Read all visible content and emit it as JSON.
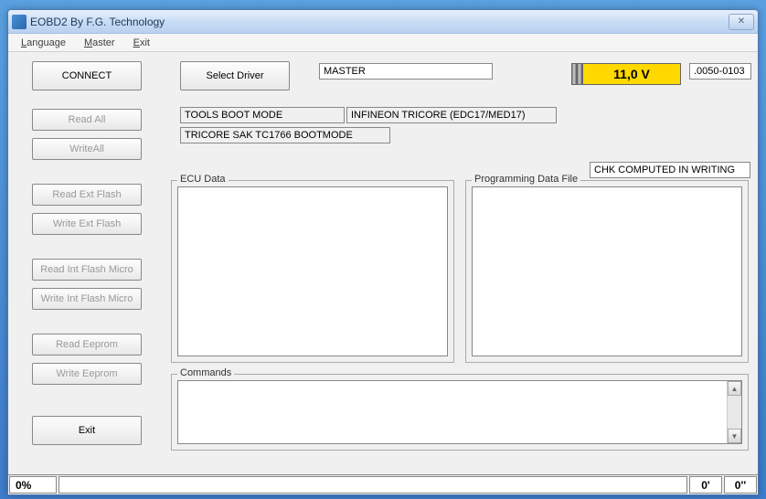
{
  "titlebar": {
    "title": "EOBD2 By F.G. Technology"
  },
  "menu": {
    "language": "Language",
    "master": "Master",
    "exit": "Exit"
  },
  "buttons": {
    "connect": "CONNECT",
    "select_driver": "Select Driver",
    "read_all": "Read All",
    "write_all": "WriteAll",
    "read_ext_flash": "Read Ext Flash",
    "write_ext_flash": "Write Ext Flash",
    "read_int_flash_micro": "Read Int Flash Micro",
    "write_int_flash_micro": "Write Int Flash Micro",
    "read_eeprom": "Read Eeprom",
    "write_eeprom": "Write Eeprom",
    "exit": "Exit"
  },
  "fields": {
    "master": "MASTER",
    "voltage": "11,0 V",
    "code": ".0050-0103",
    "tools_boot_mode": "TOOLS BOOT MODE",
    "infineon": "INFINEON TRICORE (EDC17/MED17)",
    "tricore": "TRICORE SAK TC1766  BOOTMODE",
    "chk": "CHK COMPUTED IN WRITING"
  },
  "groups": {
    "ecu_data": "ECU Data",
    "programming_data_file": "Programming Data File",
    "commands": "Commands"
  },
  "status": {
    "progress": "0%",
    "time1": "0'",
    "time2": "0''"
  }
}
